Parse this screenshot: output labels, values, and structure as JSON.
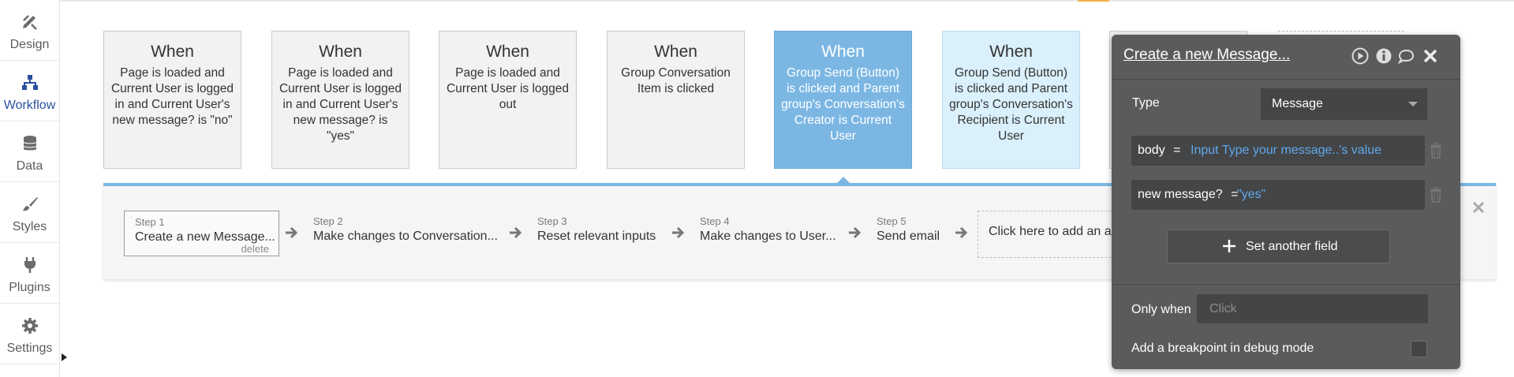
{
  "sidebar": {
    "items": [
      {
        "label": "Design",
        "icon": "design-icon"
      },
      {
        "label": "Workflow",
        "icon": "workflow-icon"
      },
      {
        "label": "Data",
        "icon": "database-icon"
      },
      {
        "label": "Styles",
        "icon": "brush-icon"
      },
      {
        "label": "Plugins",
        "icon": "plug-icon"
      },
      {
        "label": "Settings",
        "icon": "gear-icon"
      }
    ],
    "active": "Workflow"
  },
  "events": [
    {
      "when": "When",
      "condition": "Page is loaded and Current User is logged in and Current User's new message? is \"no\""
    },
    {
      "when": "When",
      "condition": "Page is loaded and Current User is logged in and Current User's new message? is \"yes\""
    },
    {
      "when": "When",
      "condition": "Page is loaded and Current User is logged out"
    },
    {
      "when": "When",
      "condition": "Group Conversation Item is clicked"
    },
    {
      "when": "When",
      "condition": "Group Send (Button) is clicked and Parent group's Conversation's Creator is Current User"
    },
    {
      "when": "When",
      "condition": "Group Send (Button) is clicked and Parent group's Conversation's Recipient is Current User"
    }
  ],
  "steps": [
    {
      "num": "Step 1",
      "title": "Create a new Message...",
      "delete_label": "delete"
    },
    {
      "num": "Step 2",
      "title": "Make changes to Conversation..."
    },
    {
      "num": "Step 3",
      "title": "Reset relevant inputs"
    },
    {
      "num": "Step 4",
      "title": "Make changes to User..."
    },
    {
      "num": "Step 5",
      "title": "Send email"
    }
  ],
  "add_action_label": "Click here to add an action...",
  "panel": {
    "title": "Create a new Message...",
    "type_label": "Type",
    "type_value": "Message",
    "fields": [
      {
        "name": "body",
        "eq": "=",
        "value": "Input Type your message..'s value"
      },
      {
        "name": "new message?",
        "eq": "=",
        "value": "\"yes\""
      }
    ],
    "set_field_label": "Set another field",
    "only_when_label": "Only when",
    "only_when_placeholder": "Click",
    "breakpoint_label": "Add a breakpoint in debug mode"
  },
  "colors": {
    "selected_card": "#7cb7e4",
    "light_card": "#daf0fb",
    "panel_bg": "#5a5b5c",
    "link_blue": "#5ea8ee",
    "active_nav": "#2b4f9f"
  }
}
